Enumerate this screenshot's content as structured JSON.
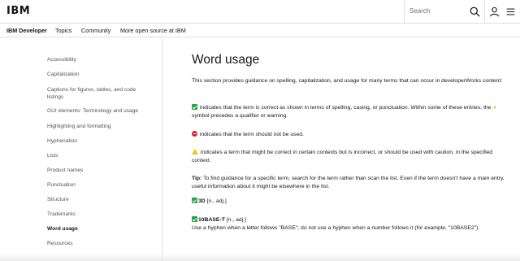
{
  "masthead": {
    "logo": "IBM",
    "search_placeholder": "Search",
    "icons": [
      "search-icon",
      "user-icon",
      "menu-icon"
    ]
  },
  "subnav": {
    "brand": "IBM Developer",
    "items": [
      "Topics",
      "Community",
      "More open source at IBM"
    ]
  },
  "sidebar": {
    "items": [
      {
        "label": "Accessibility"
      },
      {
        "label": "Capitalization"
      },
      {
        "label": "Captions for figures, tables, and code listings"
      },
      {
        "label": "GUI elements: Terminology and usage"
      },
      {
        "label": "Highlighting and formatting"
      },
      {
        "label": "Hyphenation"
      },
      {
        "label": "Lists"
      },
      {
        "label": "Product names"
      },
      {
        "label": "Punctuation"
      },
      {
        "label": "Structure"
      },
      {
        "label": "Trademarks"
      },
      {
        "label": "Word usage",
        "active": true
      },
      {
        "label": "Resources"
      }
    ]
  },
  "main": {
    "title": "Word usage",
    "intro": "This section provides guidance on spelling, capitalization, and usage for many terms that can occur in developerWorks content:",
    "correct_part1": " indicates that the term is correct as shown in terms of spelling, casing, or punctuation. Within some of these entries, the ",
    "correct_part2": " symbol precedes a qualifier or warning.",
    "not_used": " indicates that the term should not be used.",
    "caution": " indicates a term that might be correct in certain contexts but is incorrect, or should be used with caution, in the specified context.",
    "tip_label": "Tip:",
    "tip_text": " To find guidance for a specific term, search for the term rather than scan the list. Even if the term doesn't have a main entry, useful information about it might be elsewhere in the list.",
    "entries": [
      {
        "term": "3D",
        "pos": " [n., adj.]",
        "note": ""
      },
      {
        "term": "10BASE-T",
        "pos": " [n., adj.]",
        "note": "Use a hyphen when a letter follows \"BASE\"; do not use a hyphen when a number follows it (for example, \"10BASE2\")."
      }
    ]
  },
  "colors": {
    "correct": "#24a148",
    "not_used": "#da1e28",
    "caution": "#f1c21b"
  }
}
